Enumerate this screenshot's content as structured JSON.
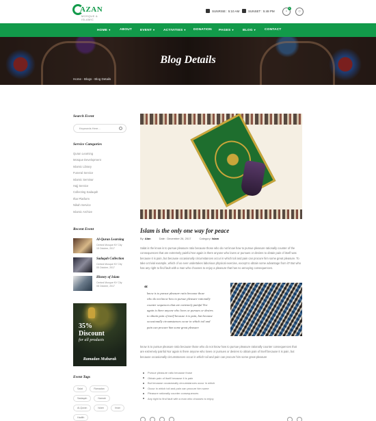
{
  "header": {
    "logo_text": "AZAN",
    "logo_sub": "MOSQUE & ISLAMIC",
    "sunrise_label": "SUNRISE : 5:10 AM",
    "sunset_label": "SUNSET : 5:48 PM",
    "cart_count": "0"
  },
  "nav": {
    "items": [
      {
        "label": "HOME",
        "caret": true
      },
      {
        "label": "ABOUT",
        "caret": false
      },
      {
        "label": "EVENT",
        "caret": true
      },
      {
        "label": "ACTIVITIES",
        "caret": true
      },
      {
        "label": "DONATION",
        "caret": false
      },
      {
        "label": "PAGES",
        "caret": true
      },
      {
        "label": "BLOG",
        "caret": true
      },
      {
        "label": "CONTACT",
        "caret": false
      }
    ]
  },
  "hero": {
    "title": "Blog Details",
    "breadcrumb": "Home - Blogs - Blog Details"
  },
  "sidebar": {
    "search_heading": "Search Event",
    "search_placeholder": "Keywords Here...",
    "categories_heading": "Service Categories",
    "categories": [
      "Quran Learning",
      "Mosque Development",
      "Islamic Library",
      "Funeral Service",
      "Islamic Seminar",
      "Hajj Service",
      "Collecting Sadaqah",
      "Iftar Platform",
      "Nikah Service",
      "Islamic Archive"
    ],
    "recent_heading": "Recent Event",
    "recent": [
      {
        "title": "Al-Quran Learning",
        "location": "Central Mosque NY City",
        "date": "15 October, 2017"
      },
      {
        "title": "Sadaqah Collection",
        "location": "Central Mosque NY City",
        "date": "05 October, 2017"
      },
      {
        "title": "History of Islam",
        "location": "Central Mosque NY City",
        "date": "08 October, 2017"
      }
    ],
    "promo": {
      "line1": "35%",
      "line2": "Discount",
      "line3": "for all products",
      "line4": "Ramadan Mubarak"
    },
    "tags_heading": "Event Tags",
    "tags": [
      "Salat",
      "Ramadan",
      "Sadaqah",
      "Namah",
      "Al-Quran",
      "Islam",
      "Iman",
      "Hadith"
    ]
  },
  "post": {
    "title": "Islam is the only one way for peace",
    "by_label": "By:",
    "author": "Alan",
    "date": "Date : December 26, 2017",
    "category_label": "Category:",
    "category": "Islam",
    "para1": [
      "Salat is the know is to pursue pleasure ratio because those who do not know how to pursue pleasure rationally counter of the",
      "consequences that are extremely painful Nor again is there anyone who loves or pursues or desires to obtain pain of itself was",
      "because it is pain, but because occasionally circumstances occur in which toil and pain can procure him some great pleasure. To",
      "take a trivial example, which of us ever undertakes laborious physical exercise, except to obtain some advantage from it? But who",
      "has any right to find fault with a man who chooses to enjoy a pleasure that has no annoying consequences."
    ],
    "quote": [
      "know is to pursue pleasure ratio because those",
      "who do not know how to pursue pleasure rationally",
      "counter sequences that are extremely painful Nor",
      "again is there anyone who loves or pursues or desires",
      "to obtain pain of itself because it is pain, but because",
      "occasionally circumstances occur in which toil and",
      "pain can procure him some great pleasure"
    ],
    "para2": [
      "know is to pursue pleasure ratio because those who do not know how to pursue pleasure rationally counter consequences that",
      "are extremely painful Nor again is there anyone who loves or pursues or desires to obtain pain of itself because it is pain, but",
      "because occasionally circumstances occur in which toil and pain can procure him some great pleasure"
    ],
    "bullets": [
      "Pursue pleasure ratio because those",
      "Obtain pain of itself because it is pain",
      "But because occasionally circumstances occur in which",
      "Occur in which toil and pain can procure him some",
      "Pleasure rationally counter consequences",
      "Any right to find fault with a man who chooses to enjoy"
    ]
  }
}
